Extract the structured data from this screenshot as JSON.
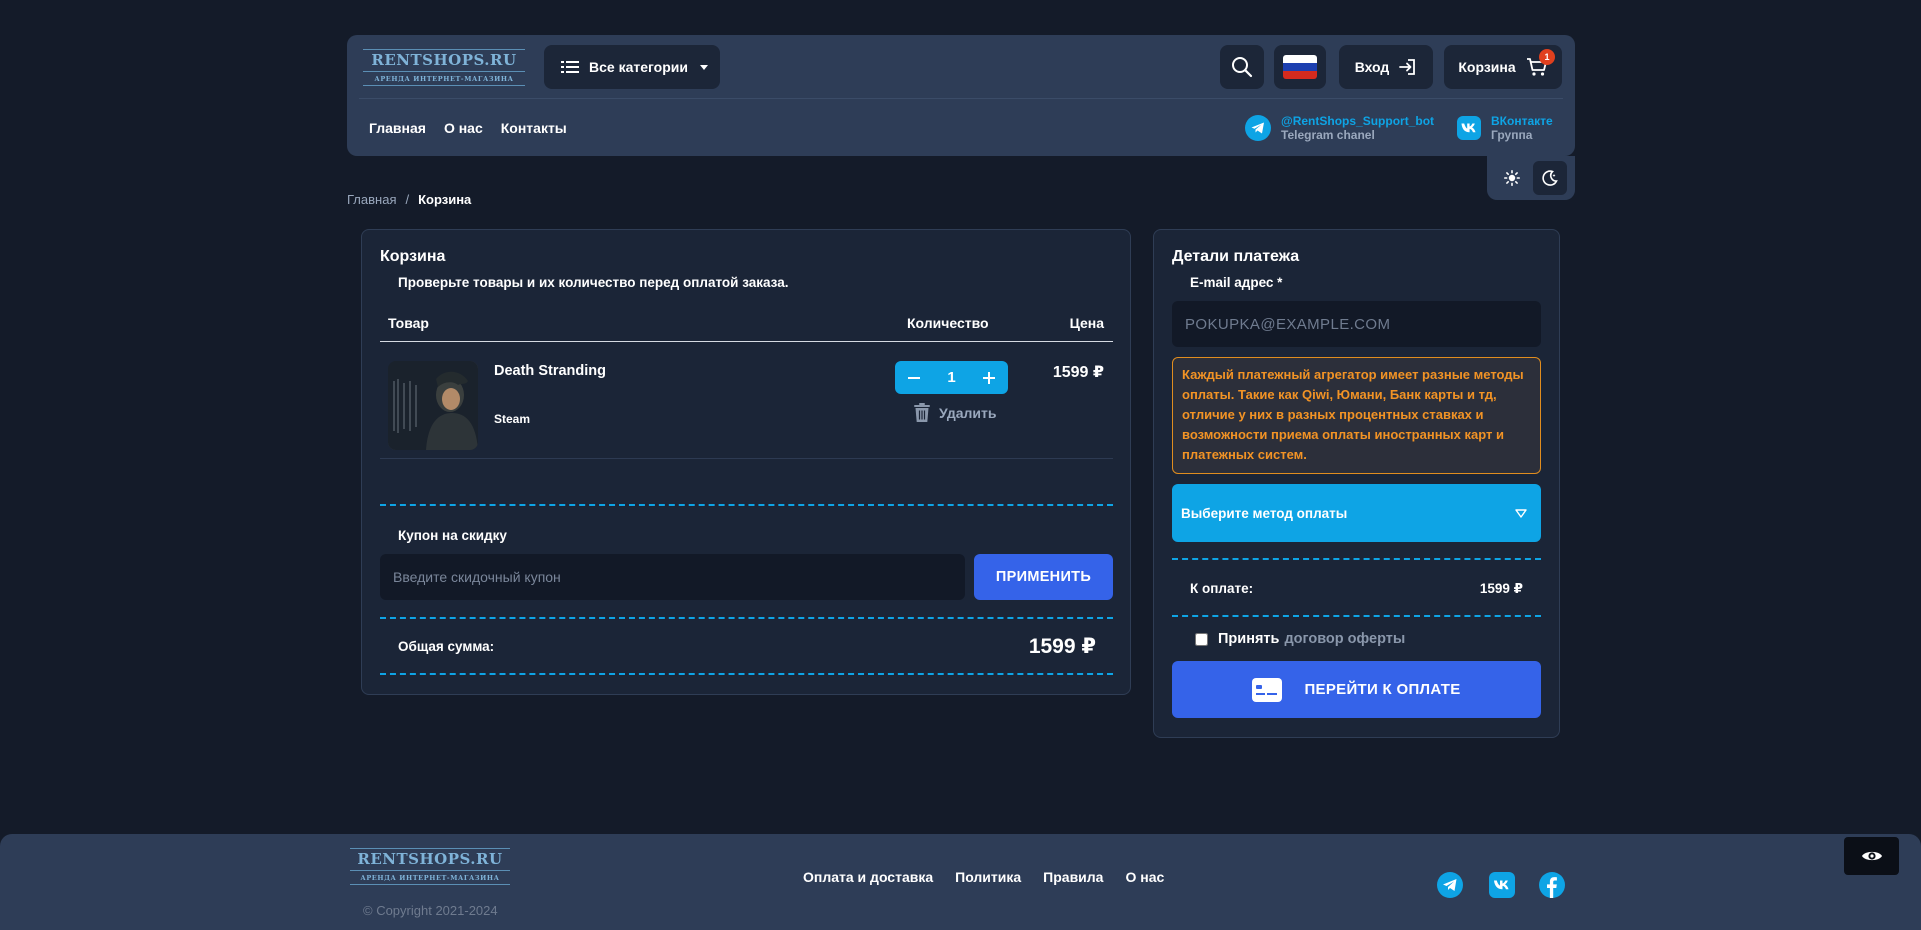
{
  "header": {
    "logo": {
      "main": "RENTSHOPS.RU",
      "sub": "АРЕНДА ИНТЕРНЕТ-МАГАЗИНА"
    },
    "categories_label": "Все категории",
    "login_label": "Вход",
    "cart_label": "Корзина",
    "cart_count": "1",
    "nav": [
      "Главная",
      "О нас",
      "Контакты"
    ],
    "telegram": {
      "title": "@RentShops_Support_bot",
      "sub": "Telegram chanel"
    },
    "vk": {
      "title": "ВКонтакте",
      "sub": "Группа"
    },
    "flag_colors": [
      "#ffffff",
      "#1c3fb0",
      "#d52b1e"
    ]
  },
  "breadcrumb": {
    "home": "Главная",
    "sep": "/",
    "current": "Корзина"
  },
  "cart": {
    "title": "Корзина",
    "subtitle": "Проверьте товары и их количество перед оплатой заказа.",
    "columns": {
      "product": "Товар",
      "quantity": "Количество",
      "price": "Цена"
    },
    "items": [
      {
        "name": "Death Stranding",
        "platform": "Steam",
        "quantity": "1",
        "price": "1599 ₽",
        "delete_label": "Удалить"
      }
    ],
    "coupon_label": "Купон на скидку",
    "coupon_placeholder": "Введите скидочный купон",
    "apply_label": "ПРИМЕНИТЬ",
    "total_label": "Общая сумма:",
    "total_value": "1599 ₽"
  },
  "payment": {
    "title": "Детали платежа",
    "email_label": "E-mail адрес *",
    "email_placeholder": "POKUPKA@EXAMPLE.COM",
    "notice": "Каждый платежный агрегатор имеет разные методы оплаты. Такие как Qiwi, Юмани, Банк карты и тд, отличие у них в разных процентных ставках и возможности приема оплаты иностранных карт и платежных систем.",
    "method_placeholder": "Выберите метод оплаты",
    "to_pay_label": "К оплате:",
    "to_pay_value": "1599 ₽",
    "accept_label": "Принять",
    "offer_label": "договор оферты",
    "go_label": "ПЕРЕЙТИ К ОПЛАТЕ"
  },
  "footer": {
    "logo": {
      "main": "RENTSHOPS.RU",
      "sub": "АРЕНДА ИНТЕРНЕТ-МАГАЗИНА"
    },
    "copyright": "© Copyright 2021-2024",
    "links": [
      "Оплата и доставка",
      "Политика",
      "Правила",
      "О нас"
    ],
    "social_icons": [
      "telegram-icon",
      "vk-icon",
      "facebook-icon"
    ]
  },
  "colors": {
    "background": "#141b29",
    "panel": "#1b2537",
    "header": "#2e3d57",
    "accent_cyan": "#0ea4e5",
    "accent_blue": "#3563e9",
    "warning": "#f29325"
  }
}
